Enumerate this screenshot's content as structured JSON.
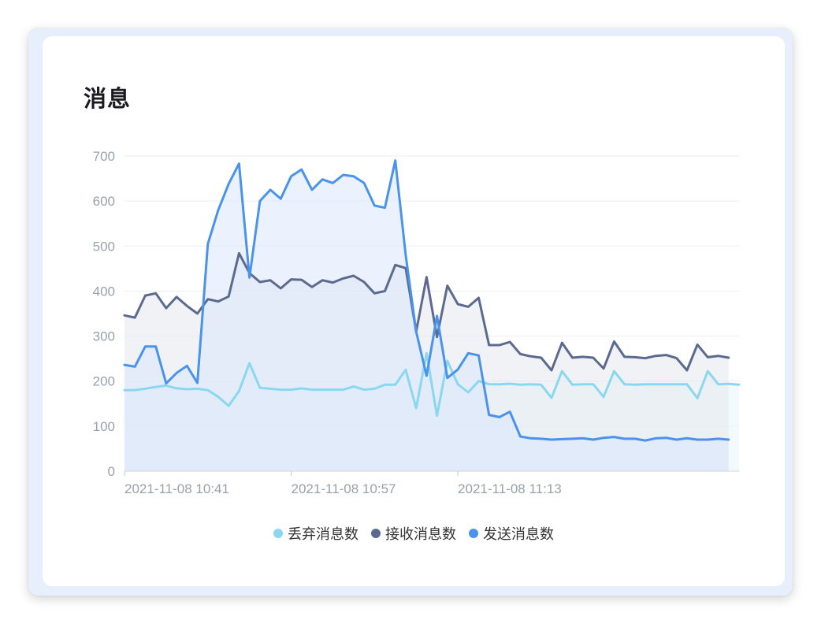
{
  "card": {
    "title": "消息"
  },
  "chart_data": {
    "type": "area",
    "title": "消息",
    "ylim": [
      0,
      700
    ],
    "yticks": [
      0,
      100,
      200,
      300,
      400,
      500,
      600,
      700
    ],
    "xtick_labels": [
      "2021-11-08 10:41",
      "2021-11-08 10:57",
      "2021-11-08 11:13"
    ],
    "xtick_indices": [
      0,
      16,
      32
    ],
    "grid": true,
    "legend_position": "bottom",
    "series": [
      {
        "name": "丢弃消息数",
        "color": "#8ad8f0",
        "fill": "#eaf6fb",
        "values": [
          180,
          180,
          183,
          187,
          190,
          184,
          182,
          183,
          180,
          165,
          145,
          178,
          240,
          185,
          183,
          181,
          181,
          184,
          181,
          181,
          181,
          181,
          188,
          181,
          183,
          192,
          192,
          225,
          140,
          262,
          123,
          245,
          193,
          175,
          200,
          193,
          193,
          194,
          192,
          193,
          192,
          163,
          222,
          192,
          193,
          193,
          165,
          222,
          193,
          192,
          193,
          193,
          193,
          193,
          193,
          162,
          222,
          193,
          194,
          192
        ]
      },
      {
        "name": "接收消息数",
        "color": "#5b6a8e",
        "fill": "#e4e8ef",
        "values": [
          346,
          341,
          390,
          395,
          362,
          387,
          367,
          350,
          382,
          377,
          388,
          484,
          440,
          420,
          424,
          406,
          426,
          425,
          409,
          424,
          419,
          428,
          434,
          420,
          395,
          400,
          458,
          451,
          310,
          431,
          298,
          412,
          371,
          365,
          385,
          280,
          280,
          287,
          260,
          255,
          252,
          224,
          285,
          252,
          254,
          252,
          228,
          288,
          254,
          253,
          251,
          256,
          258,
          251,
          224,
          281,
          253,
          256,
          252
        ]
      },
      {
        "name": "发送消息数",
        "color": "#4a93eb",
        "fill": "#dbe8fb",
        "values": [
          236,
          232,
          277,
          277,
          195,
          218,
          234,
          196,
          505,
          580,
          638,
          683,
          430,
          600,
          625,
          605,
          655,
          670,
          625,
          648,
          640,
          658,
          655,
          640,
          590,
          585,
          690,
          480,
          310,
          212,
          345,
          207,
          226,
          262,
          257,
          125,
          120,
          132,
          77,
          73,
          72,
          70,
          71,
          72,
          73,
          70,
          74,
          76,
          72,
          72,
          68,
          73,
          74,
          70,
          73,
          70,
          70,
          72,
          70
        ]
      }
    ]
  }
}
